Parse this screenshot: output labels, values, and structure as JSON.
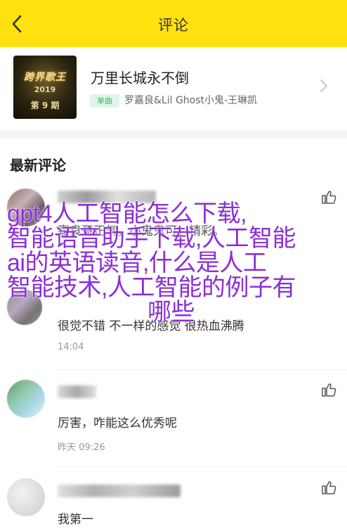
{
  "header": {
    "title": "评论"
  },
  "song": {
    "title": "万里长城永不倒",
    "badge": "单曲",
    "artist": "罗嘉良&Lil Ghost小鬼-王琳凯",
    "cover": {
      "logo": "跨界歌王",
      "year": "2019",
      "episode": "第 9 期"
    }
  },
  "section": {
    "title": "最新评论"
  },
  "comments": [
    {
      "snippet": "嘉良哥正气，小鬼鬼可，精彩。",
      "text": "很觉不错 不一样的感觉 很热血沸腾",
      "time": "14:04"
    },
    {
      "text": "厉害，咋能这么优秀呢",
      "time": "昨天 09:26"
    },
    {
      "text": "我第一"
    }
  ],
  "overlay": {
    "lines": [
      "gpt4人工智能怎么下载,",
      "智能语音助手下载,人工智能",
      "ai的英语读音,什么是人工",
      "智能技术,人工智能的例子有",
      "哪些"
    ]
  },
  "colors": {
    "header_bg": "#ffe10f",
    "badge_bg": "#dff5e6",
    "badge_text": "#3cb563",
    "overlay_text": "#8a2fd6"
  },
  "icons": {
    "back": "chevron-left-icon",
    "more": "chevron-right-icon",
    "like": "thumbs-up-icon"
  }
}
